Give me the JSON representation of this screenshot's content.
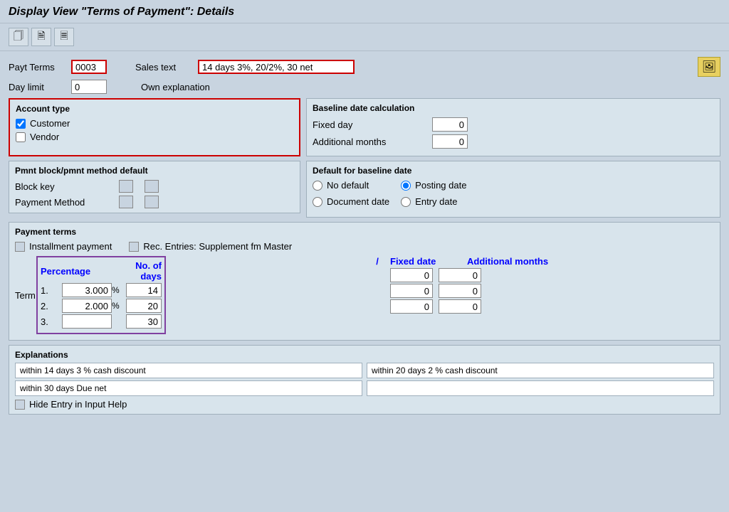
{
  "title": "Display View \"Terms of Payment\": Details",
  "toolbar": {
    "btn1_icon": "🗋",
    "btn2_icon": "🗋",
    "btn3_icon": "🖺"
  },
  "header": {
    "payt_terms_label": "Payt Terms",
    "payt_terms_value": "0003",
    "sales_text_label": "Sales text",
    "sales_text_value": "14 days 3%, 20/2%, 30 net",
    "day_limit_label": "Day limit",
    "day_limit_value": "0",
    "own_explanation_label": "Own explanation"
  },
  "account_type": {
    "title": "Account type",
    "customer_label": "Customer",
    "customer_checked": true,
    "vendor_label": "Vendor",
    "vendor_checked": false
  },
  "baseline_date": {
    "title": "Baseline date calculation",
    "fixed_day_label": "Fixed day",
    "fixed_day_value": "0",
    "additional_months_label": "Additional months",
    "additional_months_value": "0"
  },
  "pmnt_block": {
    "title": "Pmnt block/pmnt method default",
    "block_key_label": "Block key",
    "payment_method_label": "Payment Method"
  },
  "default_baseline": {
    "title": "Default for baseline date",
    "no_default_label": "No default",
    "document_date_label": "Document date",
    "posting_date_label": "Posting date",
    "entry_date_label": "Entry date",
    "posting_date_selected": true
  },
  "payment_terms": {
    "title": "Payment terms",
    "installment_label": "Installment payment",
    "rec_entries_label": "Rec. Entries: Supplement fm Master",
    "col_term": "Term",
    "col_percentage": "Percentage",
    "col_no_of_days": "No. of days",
    "col_slash": "/",
    "col_fixed_date": "Fixed date",
    "col_additional_months": "Additional months",
    "rows": [
      {
        "num": "1.",
        "percentage": "3.000",
        "days": "14",
        "fixed": "0",
        "addmon": "0"
      },
      {
        "num": "2.",
        "percentage": "2.000",
        "days": "20",
        "fixed": "0",
        "addmon": "0"
      },
      {
        "num": "3.",
        "percentage": "",
        "days": "30",
        "fixed": "0",
        "addmon": "0"
      }
    ]
  },
  "explanations": {
    "title": "Explanations",
    "row1_left": "within 14 days 3 % cash discount",
    "row1_right": "within 20 days 2 % cash discount",
    "row2_left": "within 30 days Due net",
    "row2_right": "",
    "hide_entry_label": "Hide Entry in Input Help"
  }
}
